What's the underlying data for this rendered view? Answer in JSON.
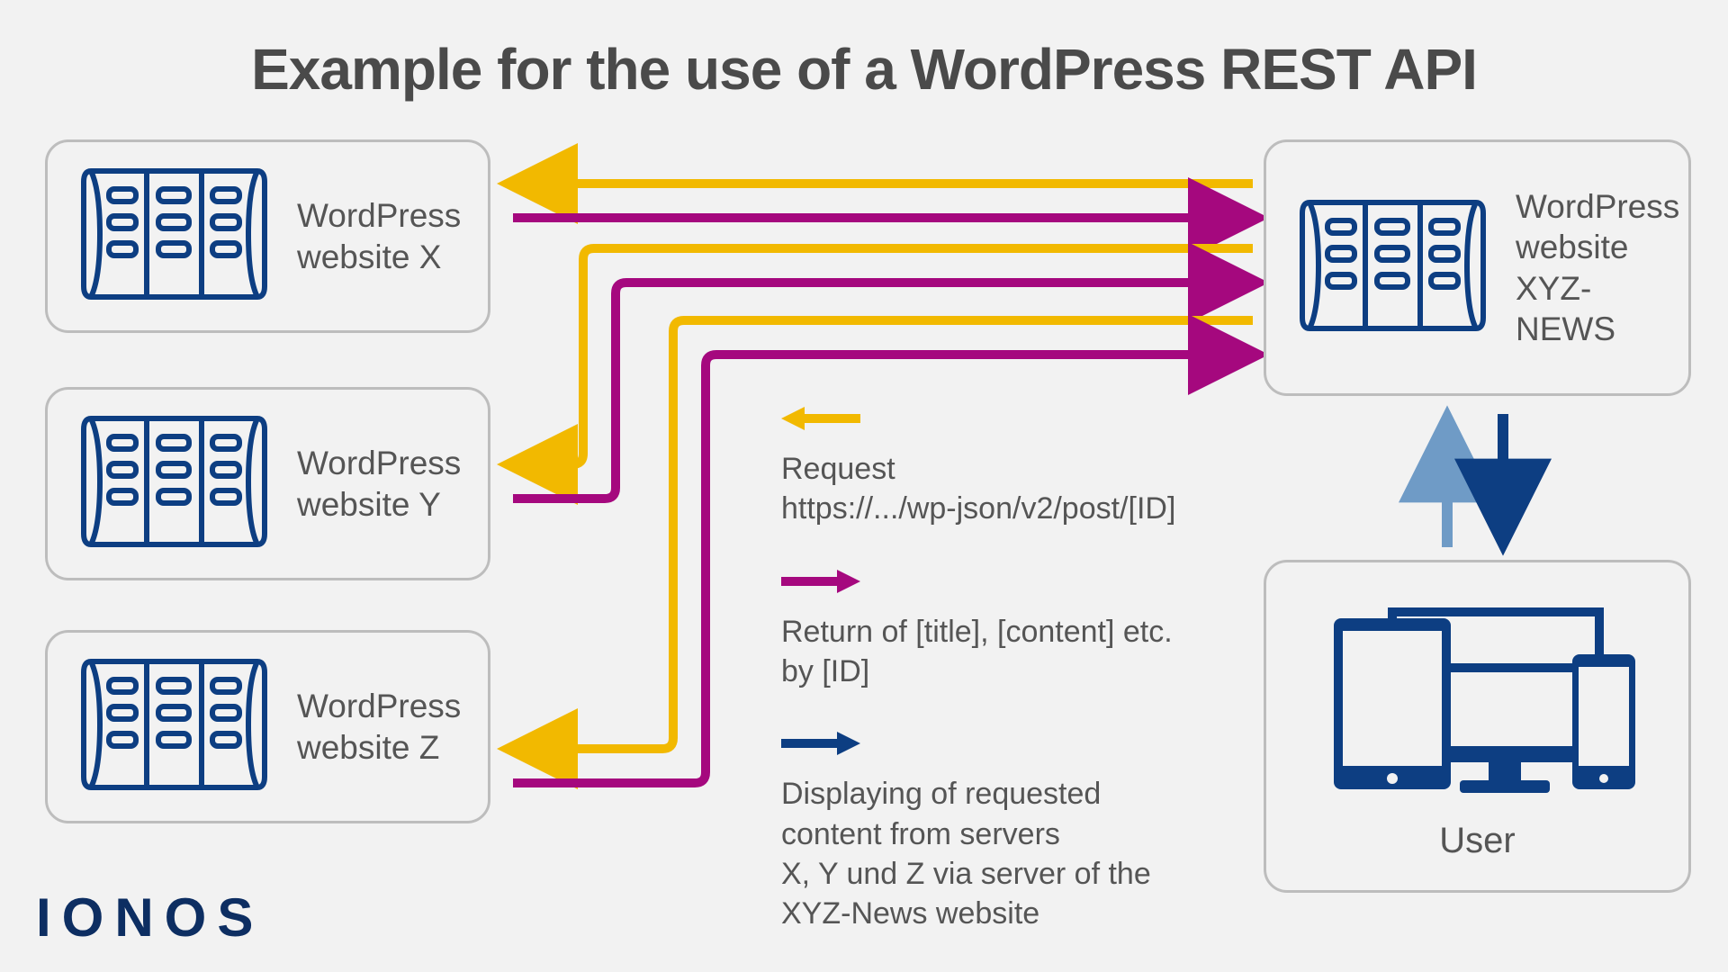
{
  "title": "Example for the use of a WordPress REST API",
  "brand": "IONOS",
  "colors": {
    "request": "#f2b900",
    "return": "#a5087e",
    "display": "#0d3e82",
    "displayLight": "#6f9bc6",
    "border": "#bdbdbd",
    "text": "#555555"
  },
  "nodes": {
    "x": {
      "label": "WordPress\nwebsite\nX"
    },
    "y": {
      "label": "WordPress\nwebsite\nY"
    },
    "z": {
      "label": "WordPress\nwebsite\nZ"
    },
    "xyz": {
      "label": "WordPress\nwebsite\nXYZ-NEWS"
    },
    "user": {
      "label": "User"
    }
  },
  "legend": {
    "request": "Request\nhttps://.../wp-json/v2/post/[ID]",
    "return": "Return of [title], [content] etc.\nby [ID]",
    "display": "Displaying of requested\ncontent from servers\nX, Y und Z via server of the\nXYZ-News website"
  }
}
